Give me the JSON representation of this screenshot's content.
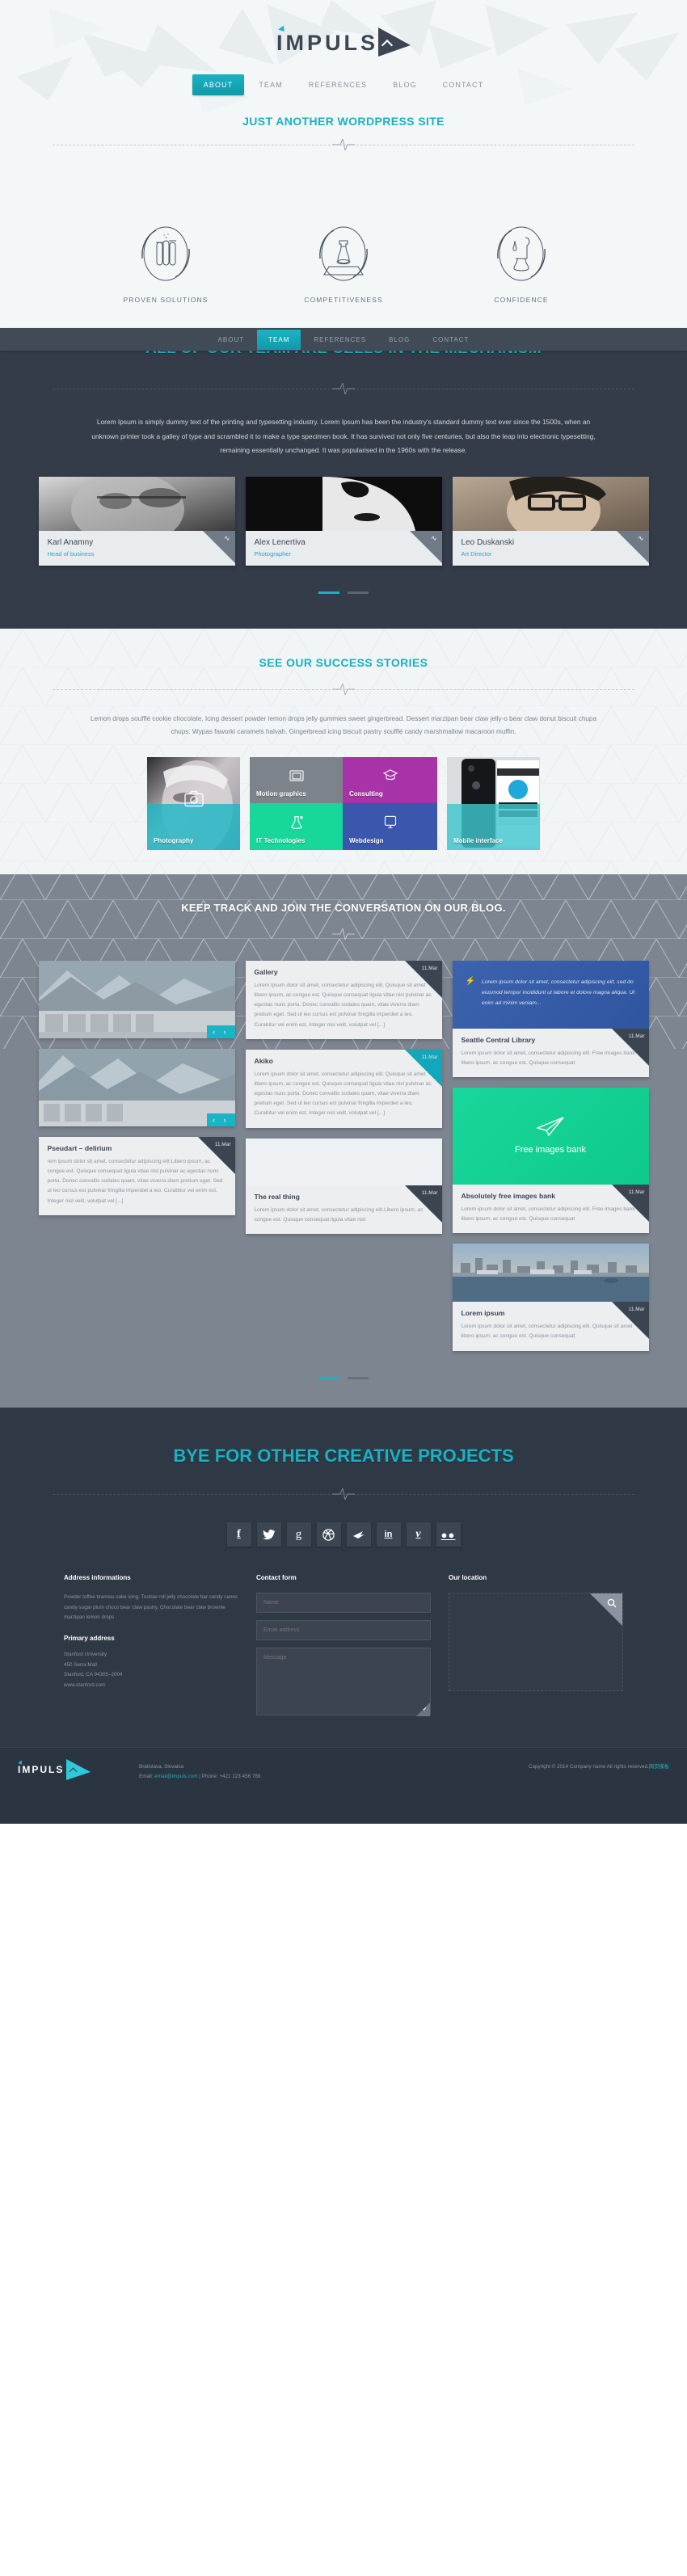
{
  "brand": {
    "name": "IMPULS"
  },
  "hero": {
    "nav": [
      {
        "label": "ABOUT",
        "active": true
      },
      {
        "label": "TEAM",
        "active": false
      },
      {
        "label": "REFERENCES",
        "active": false
      },
      {
        "label": "BLOG",
        "active": false
      },
      {
        "label": "CONTACT",
        "active": false
      }
    ],
    "tagline": "JUST ANOTHER WORDPRESS SITE"
  },
  "features": [
    {
      "label": "PROVEN SOLUTIONS",
      "icon": "test-tubes-icon"
    },
    {
      "label": "COMPETITIVENESS",
      "icon": "chess-rook-icon"
    },
    {
      "label": "CONFIDENCE",
      "icon": "pipette-flask-icon"
    }
  ],
  "team": {
    "nav": [
      {
        "label": "ABOUT",
        "active": false
      },
      {
        "label": "TEAM",
        "active": true
      },
      {
        "label": "REFERENCES",
        "active": false
      },
      {
        "label": "BLOG",
        "active": false
      },
      {
        "label": "CONTACT",
        "active": false
      }
    ],
    "title": "ALL OF OUR TEAM ARE CELLS IN THE MECHANISM",
    "paragraph": "Lorem Ipsum is simply dummy text of the printing and typesetting industry. Lorem Ipsum has been the industry's standard dummy text ever since the 1500s, when an unknown printer took a galley of type and scrambled it to make a type specimen book. It has survived not only five centuries, but also the leap into electronic typesetting, remaining essentially unchanged. It was popularised in the 1960s with the release.",
    "members": [
      {
        "name": "Karl Anamny",
        "role": "Head of business"
      },
      {
        "name": "Alex Lenertiva",
        "role": "Photographer"
      },
      {
        "name": "Leo Duskanski",
        "role": "Art Director"
      }
    ]
  },
  "success": {
    "title": "SEE OUR SUCCESS STORIES",
    "paragraph": "Lemon drops soufflé cookie chocolate. Icing dessert powder lemon drops jelly gummies sweet gingerbread. Dessert marzipan bear claw jelly-o bear claw donut biscuit chupa chups. Wypas faworki caramels halvah. Gingerbread icing biscuit pastry soufflé candy marshmallow macaroon muffin.",
    "tiles": [
      {
        "label": "Photography",
        "icon": "camera-icon",
        "color": "#1fb6c4"
      },
      {
        "label": "Motion graphics",
        "icon": "film-icon",
        "color": "#7c838b"
      },
      {
        "label": "Consulting",
        "icon": "graduation-icon",
        "color": "#a832a8"
      },
      {
        "label": "IT Technologies",
        "icon": "flask-icon",
        "color": "#18d79a"
      },
      {
        "label": "Webdesign",
        "icon": "monitor-icon",
        "color": "#3a56ad"
      },
      {
        "label": "Mobile interface",
        "icon": "phone-icon",
        "color": "#3fc6cd"
      }
    ]
  },
  "blog": {
    "title": "KEEP TRACK AND JOIN THE CONVERSATION ON OUR BLOG.",
    "body_text": "Lorem ipsum dolor sit amet, consectetur adipiscing elit. Quisque sit amet libero ipsum, ac congue est. Quisque consequat ligula vitae nisl pulvinar ac egestas nunc porta. Donec convallis sodales quam, vitae viverra diam pretium eget. Sed ut leo cursus est pulvinar fringilla imperdiet a leo. Curabitur vel enim est. Integer nisl velit, volutpat vel [...]",
    "short_text": "Lorem ipsum dolor sit amet, consectetur adipiscing elit. Free images bank libero ipsum, ac congue est. Quisque consequat",
    "short_text2": "Lorem ipsum dolor sit amet, consectetur adipiscing elit.Libero ipsum, ac congue est. Quisque consequat ligula vitae nisl",
    "short_text3": "Lorem ipsum dolor sit amet, consectetur adipiscing elit. Quisque sit amet libero ipsum, ac congue est. Quisque consequat",
    "pseudart_text": "rem ipsum dolor sit amet, consectetur adipiscing elit.Libero ipsum, ac congue est. Quisque consequat ligula vitae nisl pulvinar ac egestas nunc porta. Donec convallis sodales quam, vitae viverra diam pretium eget. Sed ut leo cursus est pulvinar fringilla imperdiet a leo. Curabitur vel enim est. Integer nisl velit, volutpat vel [...]",
    "quote": "Lorem ipsum dolor sit amet, consectetur adipiscing elit, sed do eiusmod tempor incididunt ut labore et dolore magna aliqua. Ut enim ad minim veniam...",
    "green_label": "Free images bank",
    "posts": [
      {
        "title": "Gallery",
        "date": "11.Mar"
      },
      {
        "title": "Seattle Central Library",
        "date": "11.Mar"
      },
      {
        "title": "Akiko",
        "date": "11.Mar"
      },
      {
        "title": "Absolutely free images bank",
        "date": "11.Mar"
      },
      {
        "title": "Pseudart – delirium",
        "date": "11.Mar"
      },
      {
        "title": "The real thing",
        "date": "11.Mar"
      },
      {
        "title": "Lorem ipsum",
        "date": "11.Mar"
      }
    ],
    "slider_prev": "‹",
    "slider_next": "›"
  },
  "bye": {
    "title": "BYE FOR OTHER CREATIVE PROJECTS",
    "socials": [
      {
        "name": "facebook-icon",
        "glyph": "f"
      },
      {
        "name": "twitter-icon",
        "glyph": "✐"
      },
      {
        "name": "google-plus-icon",
        "glyph": "g"
      },
      {
        "name": "dribbble-icon",
        "glyph": "◎"
      },
      {
        "name": "forrst-icon",
        "glyph": "◢"
      },
      {
        "name": "linkedin-icon",
        "glyph": "in"
      },
      {
        "name": "vimeo-icon",
        "glyph": "v"
      },
      {
        "name": "flickr-icon",
        "glyph": "••"
      }
    ]
  },
  "contact": {
    "address_heading": "Address informations",
    "address_body": "Powder toffee tiramisu cake icing. Tootsie roll jelly chocolate bar candy canes candy sugar plum choco bear claw pastry. Chocolate bear claw brownie marzipan lemon drops.",
    "primary_heading": "Primary address",
    "primary_lines": [
      "Stanford University",
      "450 Serra Mall",
      "Stanford, CA 94305–2004",
      "www.stanford.com"
    ],
    "form_heading": "Contact form",
    "name_placeholder": "Name",
    "email_placeholder": "Email address",
    "message_placeholder": "Message",
    "location_heading": "Our location"
  },
  "footer": {
    "city": "Bratislava, Slovakia",
    "email_prefix": "Email: ",
    "email": "email@impuls.com",
    "phone": " | Phone: +421 123 456 789",
    "copyright": "Copyright © 2014 Company name All rights reserved.",
    "credit": "网页模板"
  }
}
